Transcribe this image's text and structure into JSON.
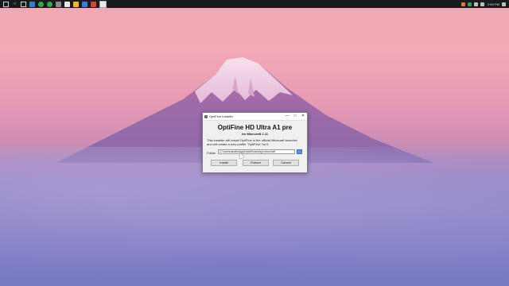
{
  "taskbar": {
    "icons": [
      "start-icon",
      "search-icon",
      "task-view-icon",
      "edge-icon",
      "spotify-icon",
      "chrome-icon",
      "settings-icon",
      "app-icon",
      "file-explorer-icon",
      "mail-icon",
      "photos-icon",
      "installer-icon"
    ],
    "clock": "2:59 PM"
  },
  "dialog": {
    "title": "OptiFine Installer",
    "heading": "OptiFine HD Ultra A1 pre",
    "subheading": "for Minecraft 1.11",
    "description_line1": "This installer will install OptiFine in the official Minecraft launcher",
    "description_line2": "and will create a new profile \"OptiFine\" for it.",
    "folder_label": "Folder",
    "folder_value": "C:\\Users\\austin\\AppData\\Roaming\\.minecraft",
    "browse_label": "...",
    "install_label": "Install",
    "extract_label": "Extract",
    "cancel_label": "Cancel",
    "minimize_label": "—",
    "maximize_label": "□",
    "close_label": "✕"
  }
}
